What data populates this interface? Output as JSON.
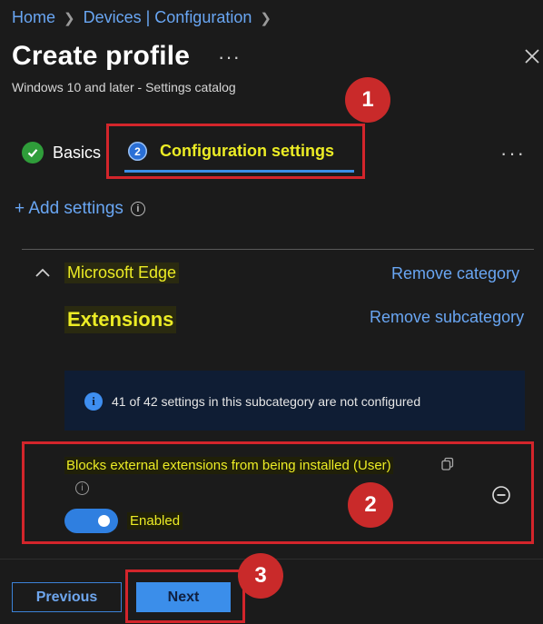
{
  "breadcrumb": {
    "home": "Home",
    "devices": "Devices | Configuration"
  },
  "header": {
    "title": "Create profile",
    "more": "···",
    "subtitle": "Windows 10 and later - Settings catalog"
  },
  "tabs": [
    {
      "label": "Basics",
      "status": "complete"
    },
    {
      "label": "Configuration settings",
      "step": "2",
      "status": "active"
    }
  ],
  "tabs_more": "···",
  "add_settings": {
    "label": "+ Add settings",
    "info": "i"
  },
  "category": {
    "name": "Microsoft Edge",
    "remove_label": "Remove category",
    "subcategory": "Extensions",
    "remove_sub_label": "Remove subcategory"
  },
  "info_banner": {
    "icon": "i",
    "text": "41 of 42 settings in this subcategory are not configured"
  },
  "setting": {
    "name": "Blocks external extensions from being installed (User)",
    "info": "i",
    "toggle_state": "on",
    "value_label": "Enabled"
  },
  "footer": {
    "previous_label": "Previous",
    "next_label": "Next"
  },
  "annotations": {
    "badge1": "1",
    "badge2": "2",
    "badge3": "3",
    "color": "#d3252b"
  }
}
